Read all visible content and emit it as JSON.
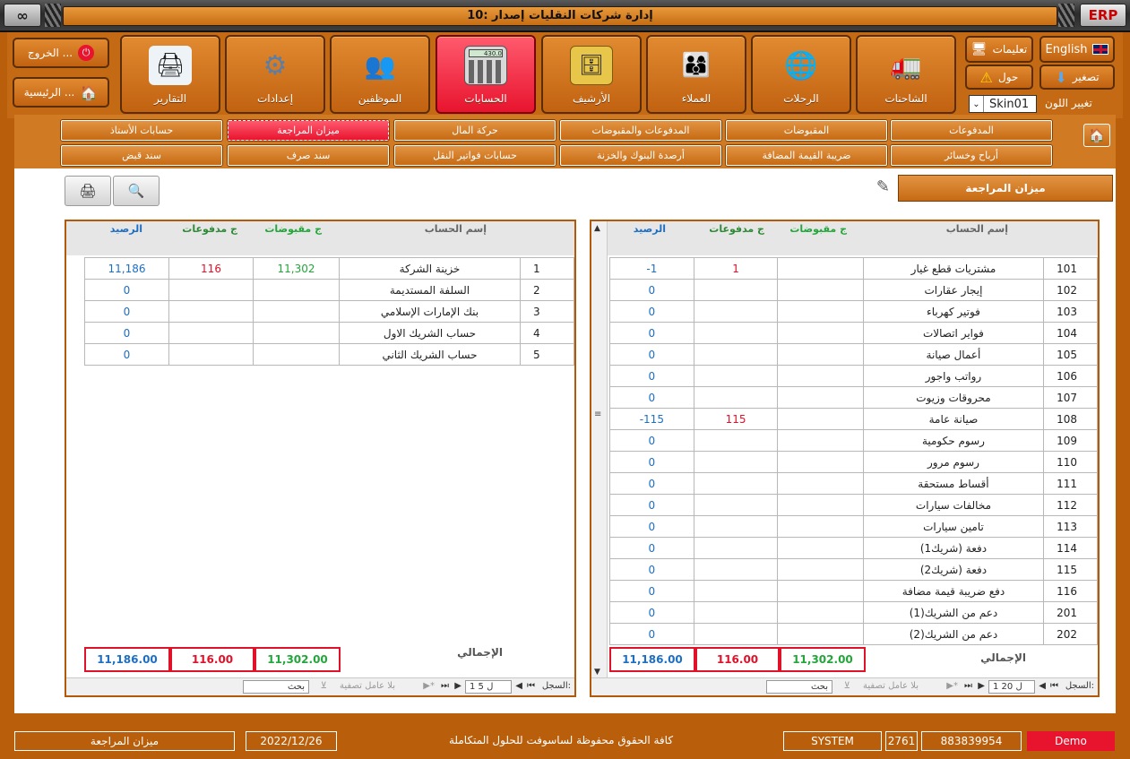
{
  "window": {
    "title": "إدارة شركات النقليات إصدار :10",
    "logo_right": "ERP",
    "logo_left": "∞"
  },
  "topnav": {
    "items": [
      {
        "label": "التقارير",
        "icon": "printer-icon"
      },
      {
        "label": "إعدادات",
        "icon": "gears-icon"
      },
      {
        "label": "الموظفين",
        "icon": "employees-icon"
      },
      {
        "label": "الحسابات",
        "icon": "calculator-icon"
      },
      {
        "label": "الأرشيف",
        "icon": "archive-icon"
      },
      {
        "label": "العملاء",
        "icon": "clients-icon"
      },
      {
        "label": "الرحلات",
        "icon": "globe-icon"
      },
      {
        "label": "الشاحنات",
        "icon": "truck-icon"
      }
    ],
    "exit_label": "الخروج ...",
    "home_label": "الرئيسية ...",
    "help_label": "تعليمات",
    "english_label": "English",
    "about_label": "حول",
    "minimize_label": "تصغير",
    "color_label": "تغيير اللون",
    "skin_value": "Skin01",
    "calc_display": "430.0"
  },
  "subnav": {
    "row1": [
      "حسابات الأستاذ",
      "ميزان المراجعة",
      "حركة المال",
      "المدفوعات والمقبوضات",
      "المقبوضات",
      "المدفوعات"
    ],
    "row2": [
      "سند قبض",
      "سند صرف",
      "حسابات فواتير النقل",
      "أرصدة البنوك والخزنة",
      "ضريبة القيمة المضافة",
      "أرباح وخسائر"
    ]
  },
  "page": {
    "title": "ميزان المراجعة"
  },
  "headers": {
    "name": "إسم الحساب",
    "received": "ج مقبوضات",
    "paid": "ج مدفوعات",
    "balance": "الرصيد"
  },
  "left_grid": {
    "rows": [
      {
        "no": "1",
        "name": "خزينة الشركة",
        "received": "11,302",
        "paid": "116",
        "balance": "11,186"
      },
      {
        "no": "2",
        "name": "السلفة المستديمة",
        "received": "",
        "paid": "",
        "balance": "0"
      },
      {
        "no": "3",
        "name": "بنك الإمارات الإسلامي",
        "received": "",
        "paid": "",
        "balance": "0"
      },
      {
        "no": "4",
        "name": "حساب الشريك الاول",
        "received": "",
        "paid": "",
        "balance": "0"
      },
      {
        "no": "5",
        "name": "حساب الشريك الثاني",
        "received": "",
        "paid": "",
        "balance": "0"
      }
    ],
    "totals": {
      "label": "الإجمالي",
      "received": "11,302.00",
      "paid": "116.00",
      "balance": "11,186.00"
    },
    "pager": {
      "record_label": "السجل:",
      "position": "1 ل 5",
      "filter_label": "بلا عامل تصفية",
      "search_label": "بحث"
    }
  },
  "right_grid": {
    "rows": [
      {
        "no": "101",
        "name": "مشتريات قطع غيار",
        "received": "",
        "paid": "1",
        "balance": "-1"
      },
      {
        "no": "102",
        "name": "إيجار عقارات",
        "received": "",
        "paid": "",
        "balance": "0"
      },
      {
        "no": "103",
        "name": "فوتير كهرباء",
        "received": "",
        "paid": "",
        "balance": "0"
      },
      {
        "no": "104",
        "name": "فواير اتصالات",
        "received": "",
        "paid": "",
        "balance": "0"
      },
      {
        "no": "105",
        "name": "أعمال صيانة",
        "received": "",
        "paid": "",
        "balance": "0"
      },
      {
        "no": "106",
        "name": "رواتب واجور",
        "received": "",
        "paid": "",
        "balance": "0"
      },
      {
        "no": "107",
        "name": "محروقات وزيوت",
        "received": "",
        "paid": "",
        "balance": "0"
      },
      {
        "no": "108",
        "name": "صيانة عامة",
        "received": "",
        "paid": "115",
        "balance": "-115"
      },
      {
        "no": "109",
        "name": "رسوم حكومية",
        "received": "",
        "paid": "",
        "balance": "0"
      },
      {
        "no": "110",
        "name": "رسوم مرور",
        "received": "",
        "paid": "",
        "balance": "0"
      },
      {
        "no": "111",
        "name": "أقساط مستحقة",
        "received": "",
        "paid": "",
        "balance": "0"
      },
      {
        "no": "112",
        "name": "مخالفات سيارات",
        "received": "",
        "paid": "",
        "balance": "0"
      },
      {
        "no": "113",
        "name": "تامين سيارات",
        "received": "",
        "paid": "",
        "balance": "0"
      },
      {
        "no": "114",
        "name": "دفعة (شريك1)",
        "received": "",
        "paid": "",
        "balance": "0"
      },
      {
        "no": "115",
        "name": "دفعة (شريك2)",
        "received": "",
        "paid": "",
        "balance": "0"
      },
      {
        "no": "116",
        "name": "دفع ضريبة قيمة مضافة",
        "received": "",
        "paid": "",
        "balance": "0"
      },
      {
        "no": "201",
        "name": "دعم من الشريك(1)",
        "received": "",
        "paid": "",
        "balance": "0"
      },
      {
        "no": "202",
        "name": "دعم من الشريك(2)",
        "received": "",
        "paid": "",
        "balance": "0"
      }
    ],
    "totals": {
      "label": "الإجمالي",
      "received": "11,302.00",
      "paid": "116.00",
      "balance": "11,186.00"
    },
    "pager": {
      "record_label": "السجل:",
      "position": "1 ل 20",
      "filter_label": "بلا عامل تصفية",
      "search_label": "بحث"
    }
  },
  "statusbar": {
    "form_name": "ميزان المراجعة",
    "date": "2022/12/26",
    "copyright": "كافة الحقوق محفوظة لساسوفت للحلول المتكاملة",
    "user": "SYSTEM",
    "code": "2761",
    "serial": "883839954",
    "mode": "Demo"
  },
  "colors": {
    "frame": "#b95e0b",
    "button": "#d47b1f",
    "active": "#e8142e",
    "received": "#23a63a",
    "paid": "#e0122a",
    "balance": "#1d6fc4"
  }
}
